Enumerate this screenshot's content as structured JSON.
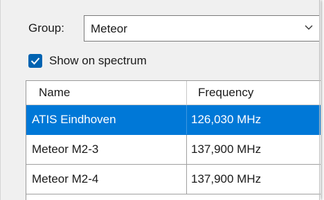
{
  "group": {
    "label": "Group:",
    "selected_value": "Meteor"
  },
  "show_on_spectrum": {
    "label": "Show on spectrum",
    "checked": true
  },
  "table": {
    "columns": [
      "Name",
      "Frequency"
    ],
    "rows": [
      {
        "name": "ATIS Eindhoven",
        "frequency": "126,030 MHz",
        "selected": true
      },
      {
        "name": "Meteor M2-3",
        "frequency": "137,900 MHz",
        "selected": false
      },
      {
        "name": "Meteor M2-4",
        "frequency": "137,900 MHz",
        "selected": false
      }
    ]
  },
  "colors": {
    "selection": "#0078d7",
    "checkbox": "#0063b1"
  },
  "icons": {
    "combo_arrow": "chevron-down-icon",
    "checkbox_mark": "checkmark-icon"
  }
}
